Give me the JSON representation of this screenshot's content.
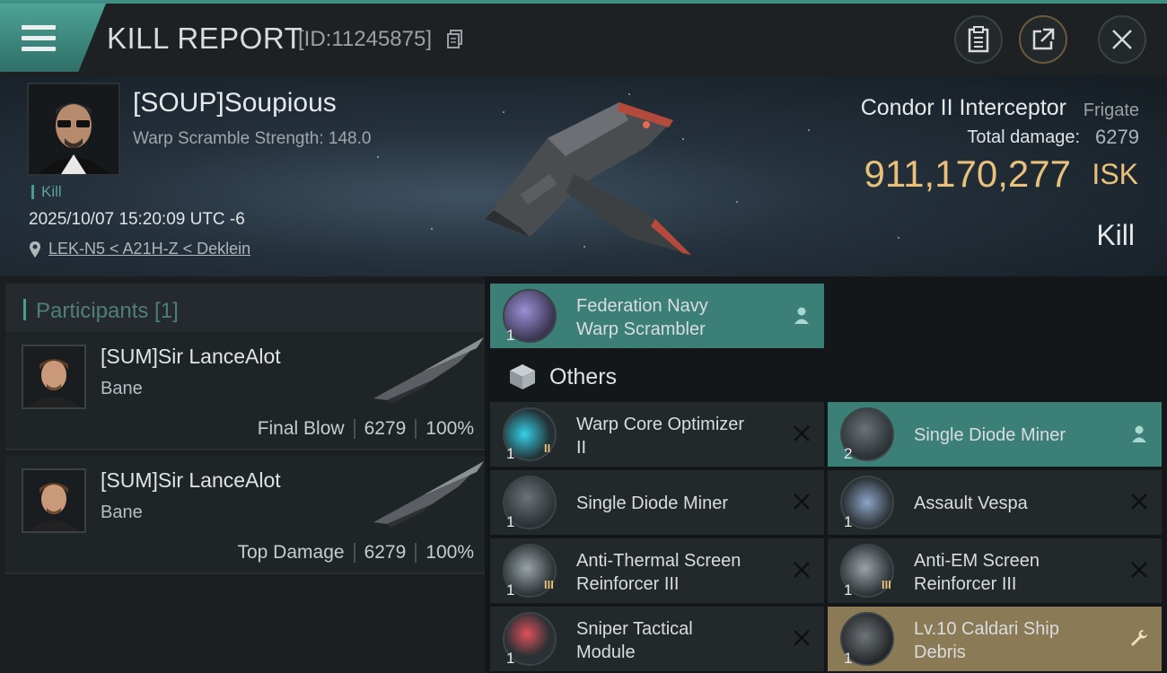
{
  "header": {
    "title": "KILL REPORT",
    "id_text": "[ID:11245875]"
  },
  "victim": {
    "name": "[SOUP]Soupious",
    "scramble": "Warp Scramble Strength: 148.0",
    "kill_tag": "Kill",
    "time": "2025/10/07 15:20:09 UTC -6",
    "location": "LEK-N5 < A21H-Z < Deklein",
    "ship_name": "Condor II Interceptor",
    "ship_class": "Frigate",
    "total_damage_label": "Total damage:",
    "total_damage": "6279",
    "isk_value": "911,170,277",
    "isk_unit": "ISK",
    "result": "Kill"
  },
  "participants": {
    "title": "Participants [1]",
    "rows": [
      {
        "name": "[SUM]Sir LanceAlot",
        "ship": "Bane",
        "label": "Final Blow",
        "damage": "6279",
        "percent": "100%"
      },
      {
        "name": "[SUM]Sir LanceAlot",
        "ship": "Bane",
        "label": "Top Damage",
        "damage": "6279",
        "percent": "100%"
      }
    ]
  },
  "fitted": {
    "item": {
      "name_line1": "Federation Navy",
      "name_line2": "Warp Scrambler",
      "qty": "1"
    }
  },
  "others": {
    "title": "Others",
    "items": [
      {
        "name_line1": "Warp Core Optimizer",
        "name_line2": "II",
        "qty": "1",
        "tier": "II",
        "state": "destroyed"
      },
      {
        "name_line1": "Single Diode Miner",
        "name_line2": "",
        "qty": "2",
        "tier": "",
        "state": "dropped"
      },
      {
        "name_line1": "Single Diode Miner",
        "name_line2": "",
        "qty": "1",
        "tier": "",
        "state": "destroyed"
      },
      {
        "name_line1": "Assault Vespa",
        "name_line2": "",
        "qty": "1",
        "tier": "",
        "state": "destroyed"
      },
      {
        "name_line1": "Anti-Thermal Screen",
        "name_line2": "Reinforcer III",
        "qty": "1",
        "tier": "III",
        "state": "destroyed"
      },
      {
        "name_line1": "Anti-EM Screen",
        "name_line2": "Reinforcer III",
        "qty": "1",
        "tier": "III",
        "state": "destroyed"
      },
      {
        "name_line1": "Sniper Tactical",
        "name_line2": "Module",
        "qty": "1",
        "tier": "",
        "state": "destroyed"
      },
      {
        "name_line1": "Lv.10 Caldari Ship",
        "name_line2": "Debris",
        "qty": "1",
        "tier": "",
        "state": "salvage"
      }
    ]
  },
  "icons": {
    "menu": "menu-icon",
    "copy": "copy-icon",
    "clipboard": "clipboard-icon",
    "share": "share-icon",
    "close": "close-icon",
    "location": "location-pin-icon",
    "person": "person-icon",
    "x": "x-icon",
    "wrench": "wrench-icon",
    "cube": "cube-icon"
  },
  "colors": {
    "accent_teal": "#3b7f77",
    "isk_gold": "#e8c17a",
    "salvage_gold": "#8a7a55"
  }
}
